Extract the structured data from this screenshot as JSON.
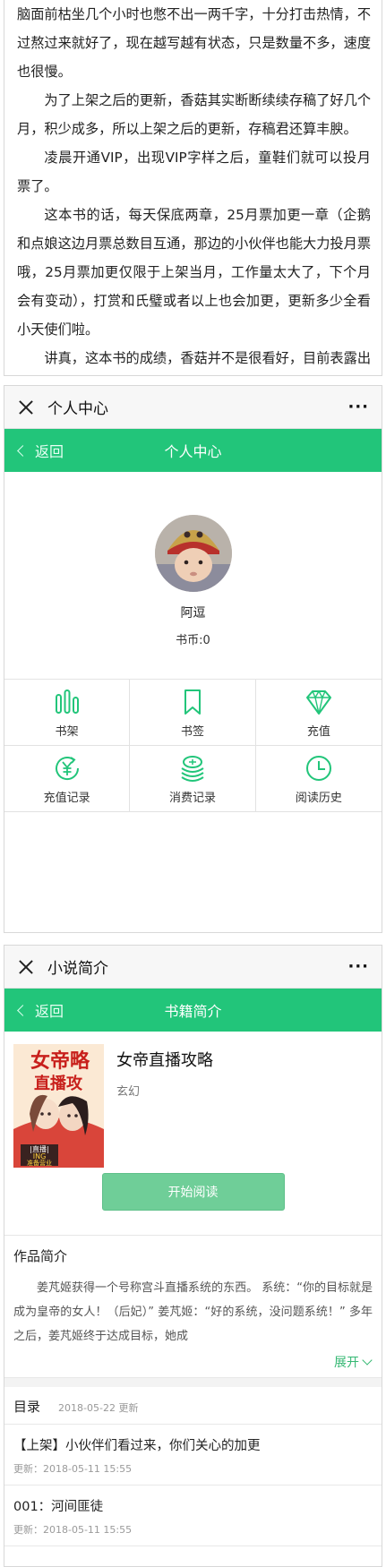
{
  "article": {
    "paragraphs": [
      "脑面前枯坐几个小时也憋不出一两千字，十分打击热情，不过熬过来就好了，现在越写越有状态，只是数量不多，速度也很慢。",
      "为了上架之后的更新，香菇其实断断续续存稿了好几个月，积少成多，所以上架之后的更新，存稿君还算丰腴。",
      "凌晨开通VIP，出现VIP字样之后，童鞋们就可以投月票了。",
      "这本书的话，每天保底两章，25月票加更一章（企鹅和点娘这边月票总数目互通，那边的小伙伴也能大力投月票哦，25月票加更仅限于上架当月，工作量太大了，下个月会有变动），打赏和氏璧或者以上也会加更，更新多少全看小天使们啦。",
      "讲真，这本书的成绩，香菇并不是很看好，目前表露出来情况也让香菇心里没底，不过开书凭热情，"
    ]
  },
  "profile_page": {
    "wx_title": "个人中心",
    "more": "···",
    "back_label": "返回",
    "header_title": "个人中心",
    "username": "阿逗",
    "coins": "书币:0",
    "menu": [
      {
        "label": "书架",
        "icon": "bookshelf-icon"
      },
      {
        "label": "书签",
        "icon": "bookmark-icon"
      },
      {
        "label": "充值",
        "icon": "diamond-icon"
      },
      {
        "label": "充值记录",
        "icon": "recharge-record-icon"
      },
      {
        "label": "消费记录",
        "icon": "coin-stack-icon"
      },
      {
        "label": "阅读历史",
        "icon": "clock-icon"
      }
    ],
    "accent_color": "#22c57a"
  },
  "novel_page": {
    "wx_title": "小说简介",
    "more": "···",
    "back_label": "返回",
    "header_title": "书籍简介",
    "book_title": "女帝直播攻略",
    "genre": "玄幻",
    "cover_text": {
      "title_a": "女帝略",
      "title_b": "直播攻",
      "tag_a": "|直播|",
      "tag_b": "ING",
      "tag_c": "准备营业"
    },
    "read_button": "开始阅读",
    "intro_title": "作品简介",
    "intro_text": "姜芃姬获得一个号称宫斗直播系统的东西。 系统：“你的目标就是成为皇帝的女人！（后妃）” 姜芃姬：“好的系统，没问题系统！” 多年之后，姜芃姬终于达成目标，她成",
    "expand_label": "展开",
    "toc_title": "目录",
    "toc_date": "2018-05-22 更新",
    "chapters": [
      {
        "name": "【上架】小伙伴们看过来，你们关心的加更",
        "updated": "更新：2018-05-11 15:55"
      },
      {
        "name": "001：河间匪徒",
        "updated": "更新：2018-05-11 15:55"
      }
    ]
  }
}
